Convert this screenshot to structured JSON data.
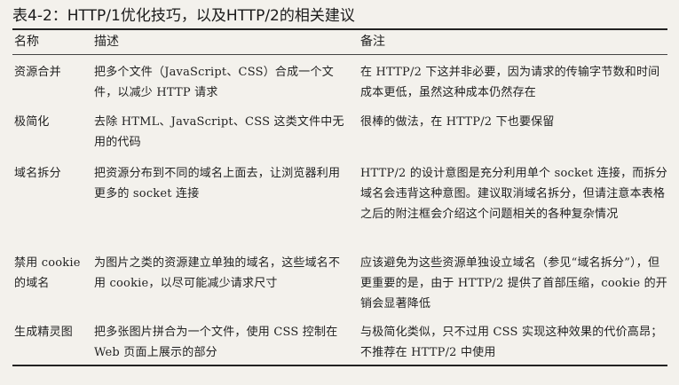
{
  "caption": "表4-2：HTTP/1优化技巧，以及HTTP/2的相关建议",
  "table": {
    "headers": [
      "名称",
      "描述",
      "备注"
    ],
    "rows": [
      {
        "name": "资源合并",
        "description": "把多个文件（JavaScript、CSS）合成一个文件，以减少 HTTP 请求",
        "note": "在 HTTP/2 下这并非必要，因为请求的传输字节数和时间成本更低，虽然这种成本仍然存在"
      },
      {
        "name": "极简化",
        "description": "去除 HTML、JavaScript、CSS 这类文件中无用的代码",
        "note": "很棒的做法，在 HTTP/2 下也要保留"
      },
      {
        "name": "域名拆分",
        "description": "把资源分布到不同的域名上面去，让浏览器利用更多的 socket 连接",
        "note": "HTTP/2 的设计意图是充分利用单个 socket 连接，而拆分域名会违背这种意图。建议取消域名拆分，但请注意本表格之后的附注框会介绍这个问题相关的各种复杂情况"
      },
      {
        "name": "禁用 cookie 的域名",
        "description": "为图片之类的资源建立单独的域名，这些域名不用 cookie，以尽可能减少请求尺寸",
        "note": "应该避免为这些资源单独设立域名（参见“域名拆分”），但更重要的是，由于 HTTP/2 提供了首部压缩，cookie 的开销会显著降低"
      },
      {
        "name": "生成精灵图",
        "description": "把多张图片拼合为一个文件，使用 CSS 控制在 Web 页面上展示的部分",
        "note": "与极简化类似，只不过用 CSS 实现这种效果的代价高昂；不推荐在 HTTP/2 中使用"
      }
    ]
  }
}
